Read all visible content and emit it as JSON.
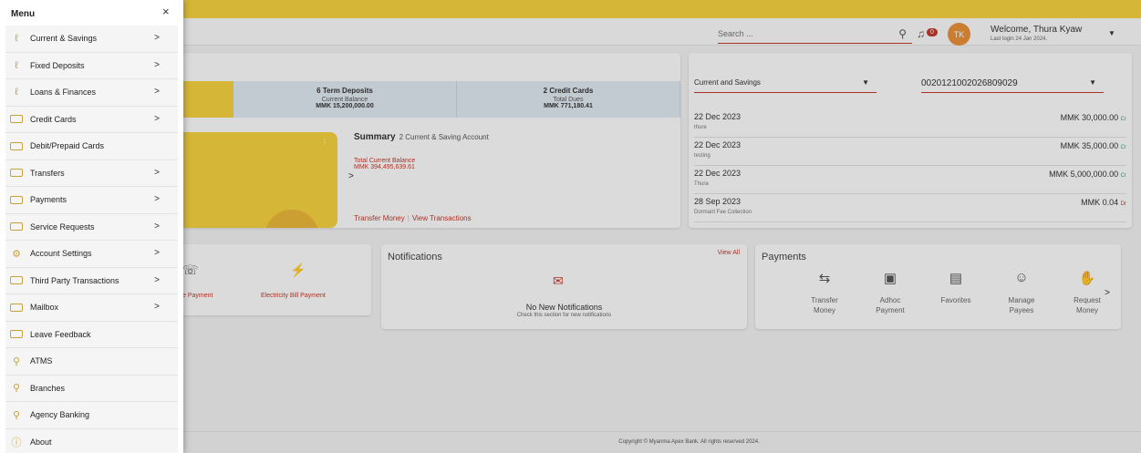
{
  "menu": {
    "title": "Menu",
    "close": "×",
    "items": [
      {
        "label": "Current & Savings",
        "icon": "people-icon",
        "glyph": "ℓ",
        "chevron": true
      },
      {
        "label": "Fixed Deposits",
        "icon": "people-icon",
        "glyph": "ℓ",
        "chevron": true
      },
      {
        "label": "Loans & Finances",
        "icon": "people-icon",
        "glyph": "ℓ",
        "chevron": true
      },
      {
        "label": "Credit Cards",
        "icon": "card-icon",
        "glyph": "",
        "chevron": true
      },
      {
        "label": "Debit/Prepaid Cards",
        "icon": "card-icon",
        "glyph": "",
        "chevron": false
      },
      {
        "label": "Transfers",
        "icon": "transfer-icon",
        "glyph": "",
        "chevron": true
      },
      {
        "label": "Payments",
        "icon": "card-icon",
        "glyph": "",
        "chevron": true
      },
      {
        "label": "Service Requests",
        "icon": "service-icon",
        "glyph": "",
        "chevron": true
      },
      {
        "label": "Account Settings",
        "icon": "gear-icon",
        "glyph": "⚙",
        "chevron": true
      },
      {
        "label": "Third Party Transactions",
        "icon": "transfer-icon",
        "glyph": "",
        "chevron": true
      },
      {
        "label": "Mailbox",
        "icon": "mail-icon",
        "glyph": "",
        "chevron": true
      },
      {
        "label": "Leave Feedback",
        "icon": "feedback-icon",
        "glyph": "",
        "chevron": false
      },
      {
        "label": "ATMS",
        "icon": "location-icon",
        "glyph": "⚲",
        "chevron": false
      },
      {
        "label": "Branches",
        "icon": "location-icon",
        "glyph": "⚲",
        "chevron": false
      },
      {
        "label": "Agency Banking",
        "icon": "location-icon",
        "glyph": "⚲",
        "chevron": false
      },
      {
        "label": "About",
        "icon": "info-icon",
        "glyph": "ⓘ",
        "chevron": false
      }
    ],
    "chevron_glyph": ">"
  },
  "header": {
    "search_placeholder": "Search ...",
    "notification_count": "0",
    "avatar_initials": "TK",
    "welcome": "Welcome, Thura Kyaw",
    "last_login": "Last login 24 Jan 2024."
  },
  "accounts": {
    "tiles": [
      {
        "title": "6 Term Deposits",
        "sub": "Current Balance",
        "amount": "MMK 15,200,000.00"
      },
      {
        "title": "2 Credit Cards",
        "sub": "Total Dues",
        "amount": "MMK 771,180.41"
      }
    ],
    "summary_title": "Summary",
    "summary_sub": "2 Current & Saving Account",
    "balance_label": "Total Current Balance",
    "balance_value": "MMK 394,495,639.61",
    "link_transfer": "Transfer Money",
    "link_sep": "|",
    "link_view": "View Transactions"
  },
  "activity": {
    "account_type": "Current and Savings",
    "account_number": "0020121002026809029",
    "transactions": [
      {
        "date": "22 Dec 2023",
        "note": "thure",
        "amount": "MMK 30,000.00",
        "kind": "Cr"
      },
      {
        "date": "22 Dec 2023",
        "note": "testing",
        "amount": "MMK 35,000.00",
        "kind": "Cr"
      },
      {
        "date": "22 Dec 2023",
        "note": "Thura",
        "amount": "MMK 5,000,000.00",
        "kind": "Cr"
      },
      {
        "date": "28 Sep 2023",
        "note": "Dormant Fee Collection",
        "amount": "MMK 0.04",
        "kind": "Dr"
      }
    ]
  },
  "quick": {
    "item1": "e Payment",
    "item2": "Electricity Bill Payment"
  },
  "notifications": {
    "title": "Notifications",
    "view_all": "View All",
    "empty": "No New Notifications",
    "hint": "Check this section for new notifications"
  },
  "payments": {
    "title": "Payments",
    "items": [
      {
        "line1": "Transfer",
        "line2": "Money"
      },
      {
        "line1": "Adhoc",
        "line2": "Payment"
      },
      {
        "line1": "Favorites",
        "line2": ""
      },
      {
        "line1": "Manage",
        "line2": "Payees"
      },
      {
        "line1": "Request",
        "line2": "Money"
      }
    ]
  },
  "footer": "Copyright © Myanma Apex Bank. All rights reserved 2024.",
  "colors": {
    "brand_yellow": "#f4d03f",
    "accent_red": "#c0392b",
    "credit_green": "#27ae60"
  }
}
